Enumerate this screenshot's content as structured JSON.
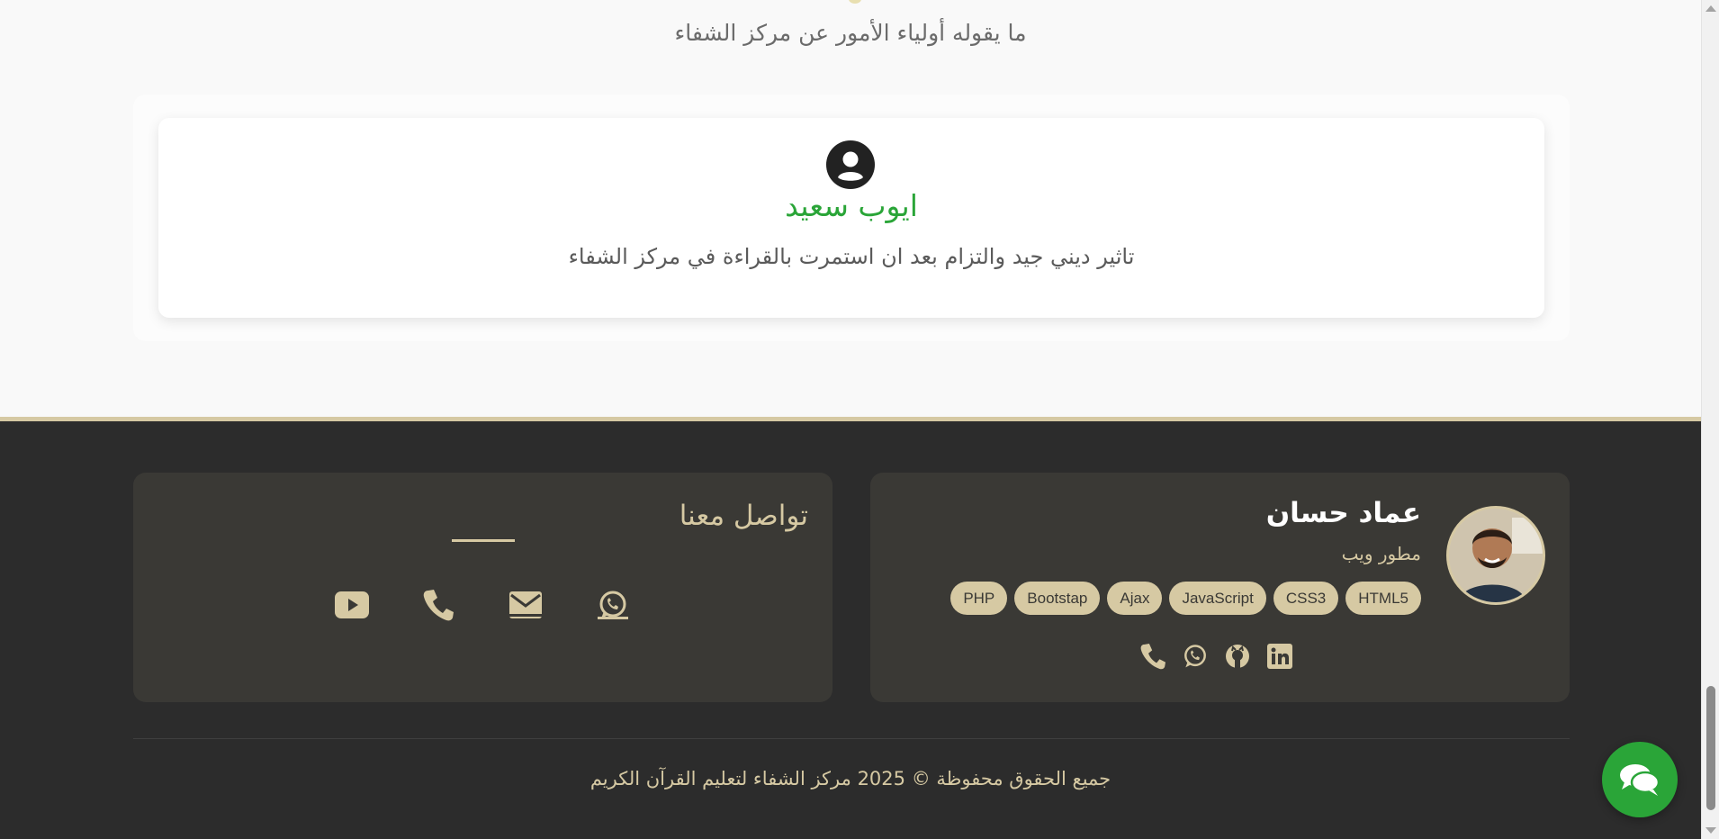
{
  "testimonials": {
    "subtitle": "ما يقوله أولياء الأمور عن مركز الشفاء",
    "items": [
      {
        "name": "ايوب سعيد",
        "text": "تاثير ديني جيد والتزام بعد ان استمرت بالقراءة في مركز الشفاء"
      }
    ]
  },
  "footer": {
    "contact": {
      "title": "تواصل معنا",
      "icons": [
        "youtube-icon",
        "phone-icon",
        "envelope-icon",
        "whatsapp-icon"
      ]
    },
    "developer": {
      "name": "عماد حسان",
      "role": "مطور ويب",
      "skills": [
        "HTML5",
        "CSS3",
        "JavaScript",
        "Ajax",
        "Bootstap",
        "PHP"
      ],
      "social_icons": [
        "phone-icon",
        "whatsapp-icon",
        "github-icon",
        "linkedin-icon"
      ]
    },
    "copyright": "جميع الحقوق محفوظة © 2025 مركز الشفاء لتعليم القرآن الكريم"
  },
  "colors": {
    "accent": "#d6c9a3",
    "green": "#2aa538",
    "footer_bg": "#2c2c2c",
    "card_bg": "#3a3935"
  }
}
